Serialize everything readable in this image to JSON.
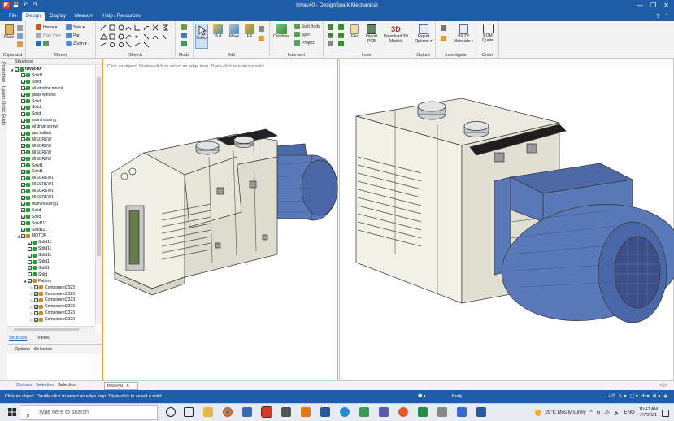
{
  "window": {
    "title": "trivac40 - DesignSpark Mechanical",
    "controls": [
      "—",
      "❐",
      "✕"
    ]
  },
  "quick_access": [
    "◩",
    "💾",
    "↶",
    "↷"
  ],
  "menu": {
    "items": [
      {
        "label": "File"
      },
      {
        "label": "Design",
        "active": true
      },
      {
        "label": "Display"
      },
      {
        "label": "Measure"
      },
      {
        "label": "Help / Resources"
      }
    ],
    "right": [
      "?",
      "⌃"
    ]
  },
  "ribbon": {
    "clipboard": {
      "label": "Clipboard",
      "paste": "Paste"
    },
    "orient": {
      "label": "Orient",
      "home": "Home ▾",
      "spin": "Spin ▾",
      "plan_view": "Plan View",
      "pan": "Pan",
      "zoom": "Zoom ▾"
    },
    "sketch": {
      "label": "Sketch"
    },
    "mode": {
      "label": "Mode"
    },
    "edit": {
      "label": "Edit",
      "select": "Select",
      "pull": "Pull",
      "move": "Move",
      "fill": "Fill"
    },
    "intersect": {
      "label": "Intersect",
      "combine": "Combine",
      "split_body": "Split Body",
      "split": "Split",
      "project": "Project"
    },
    "insert": {
      "label": "Insert",
      "file": "File",
      "import_pcb": "Import\nPCB",
      "download_3d": "Download 3D\nModels"
    },
    "output": {
      "label": "Output",
      "export": "Export\nOptions ▾"
    },
    "investigate": {
      "label": "Investigate",
      "bill": "Bill Of\nMaterials ▾"
    },
    "order": {
      "label": "Order",
      "bom_quote": "BOM\nQuote"
    }
  },
  "side_tabs": [
    "Properties",
    "Layers",
    "Quick Guide"
  ],
  "structure": {
    "title": "Structure",
    "tree": [
      {
        "label": "trivac40*",
        "level": 0,
        "bold": true,
        "expand": "◢"
      },
      {
        "label": "Solid1",
        "level": 1
      },
      {
        "label": "Solid",
        "level": 1
      },
      {
        "label": "oil window mount",
        "level": 1
      },
      {
        "label": "glass window",
        "level": 1
      },
      {
        "label": "Solid",
        "level": 1
      },
      {
        "label": "Solid",
        "level": 1
      },
      {
        "label": "Solid",
        "level": 1
      },
      {
        "label": "main housing",
        "level": 1
      },
      {
        "label": "oil drain screw",
        "level": 1
      },
      {
        "label": "gas ballast",
        "level": 1
      },
      {
        "label": "MISCREW",
        "level": 1
      },
      {
        "label": "MISCREW",
        "level": 1
      },
      {
        "label": "MISCREW",
        "level": 1
      },
      {
        "label": "MISCREW",
        "level": 1
      },
      {
        "label": "Solid1",
        "level": 1
      },
      {
        "label": "Solid1",
        "level": 1
      },
      {
        "label": "MISCREW1",
        "level": 1
      },
      {
        "label": "MISCREW1",
        "level": 1
      },
      {
        "label": "MISCREW1",
        "level": 1
      },
      {
        "label": "MISCREW1",
        "level": 1
      },
      {
        "label": "main housing1",
        "level": 1
      },
      {
        "label": "Solid",
        "level": 1
      },
      {
        "label": "Solid",
        "level": 1
      },
      {
        "label": "Solid111",
        "level": 1
      },
      {
        "label": "Solid111",
        "level": 1
      },
      {
        "label": "MOTOR",
        "level": 1,
        "expand": "◢",
        "comp": true
      },
      {
        "label": "Solid11",
        "level": 2
      },
      {
        "label": "Solid11",
        "level": 2
      },
      {
        "label": "Solid11",
        "level": 2
      },
      {
        "label": "Solid1",
        "level": 2
      },
      {
        "label": "Solid1",
        "level": 2
      },
      {
        "label": "Solid",
        "level": 2
      },
      {
        "label": "Pattern",
        "level": 2,
        "expand": "◢",
        "comp": true
      },
      {
        "label": "Component2323",
        "level": 3,
        "expand": "▷",
        "comp": true
      },
      {
        "label": "Component2323",
        "level": 3,
        "expand": "▷",
        "comp": true
      },
      {
        "label": "Component2323",
        "level": 3,
        "expand": "▷",
        "comp": true
      },
      {
        "label": "Component2323",
        "level": 3,
        "expand": "▷",
        "comp": true
      },
      {
        "label": "Component2323",
        "level": 3,
        "expand": "▷",
        "comp": true
      },
      {
        "label": "Component2323",
        "level": 3,
        "expand": "▷",
        "comp": true
      }
    ],
    "tabs": [
      "Structure",
      "Views"
    ]
  },
  "options": {
    "title": "Options - Selection"
  },
  "viewport": {
    "hint": "Click an object. Double-click to select an edge loop. Triple-click to select a solid."
  },
  "bottom_tabs": {
    "options": "Options - Selection",
    "selection": "Selection",
    "document": "trivac40* ✕",
    "arrows": "◁ ▷"
  },
  "status": {
    "message": "Click an object. Double-click to select an edge loop. Triple-click to select a solid.",
    "info": "❶ ▴",
    "mode": "Body",
    "right": [
      "⇣⊙",
      "↖ ▾",
      "⬚ ▾",
      "✛ ▾",
      "⊕ ▾",
      "◈"
    ]
  },
  "taskbar": {
    "search_placeholder": "Type here to search",
    "weather": "29°C  Mostly sunny",
    "time": "10:47 AM",
    "date": "7/7/2021",
    "tray": [
      "^",
      "⊟",
      "🖧",
      "🔈",
      "ENG"
    ]
  },
  "colors": {
    "accent": "#1f5da8",
    "viewport_border": "#f0a030",
    "body_white": "#ecebdf",
    "motor_blue": "#5a79b8"
  }
}
